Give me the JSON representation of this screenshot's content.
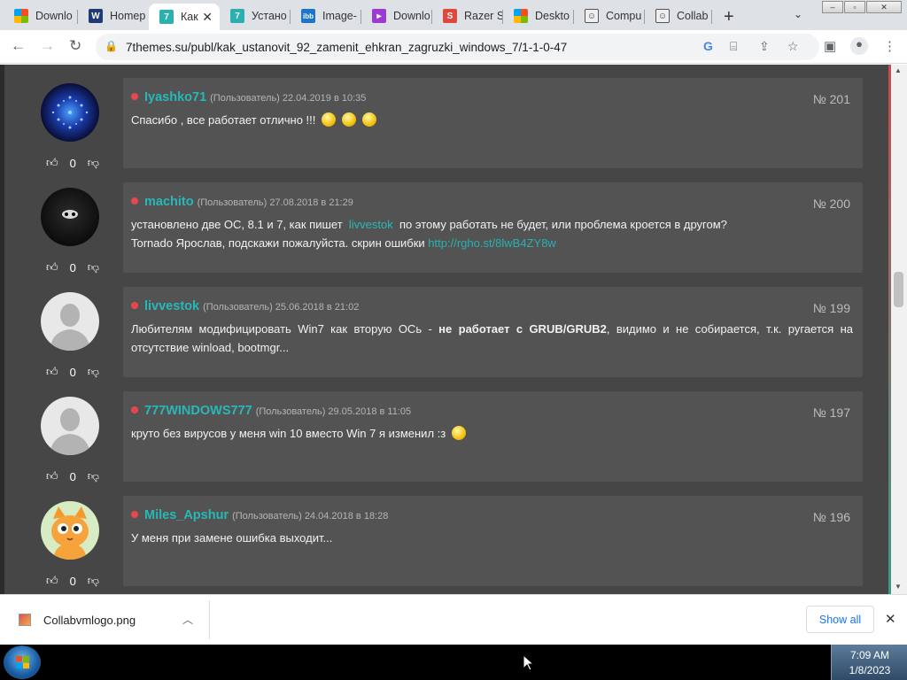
{
  "browser": {
    "tabs": [
      {
        "label": "Downlo",
        "icon": "windows-logo-icon",
        "color": "#f25022"
      },
      {
        "label": "Homep",
        "icon": "site-logo-icon",
        "color": "#1f3b73"
      },
      {
        "label": "Как",
        "icon": "7themes-icon",
        "color": "#2bb0b0",
        "active": true
      },
      {
        "label": "Устано",
        "icon": "7themes-icon",
        "color": "#2bb0b0"
      },
      {
        "label": "Image-",
        "icon": "imgbb-icon",
        "color": "#1c75c8"
      },
      {
        "label": "Downlo",
        "icon": "download-site-icon",
        "color": "#9b3bd1"
      },
      {
        "label": "Razer S",
        "icon": "razer-icon",
        "color": "#e0483e"
      },
      {
        "label": "Deskto",
        "icon": "windows-logo-icon",
        "color": "#f25022"
      },
      {
        "label": "Compu",
        "icon": "collabvm-icon",
        "color": "#555555"
      },
      {
        "label": "Collab",
        "icon": "collabvm-icon",
        "color": "#555555"
      }
    ],
    "url": "7themes.su/publ/kak_ustanovit_92_zamenit_ehkran_zagruzki_windows_7/1-1-0-47"
  },
  "comments": [
    {
      "user": "Iyashko71",
      "role": "(Пользователь)",
      "date": "22.04.2019 в 10:35",
      "number": "№ 201",
      "votes": "0",
      "avatar": "blue-sphere",
      "text": "Спасибо , все работает отлично !!!"
    },
    {
      "user": "machito",
      "role": "(Пользователь)",
      "date": "27.08.2018 в 21:29",
      "number": "№ 200",
      "votes": "0",
      "avatar": "hooded",
      "text_a": "установлено две ОС, 8.1 и 7, как пишет",
      "mention": "livvestok",
      "text_b": "по этому работать не будет, или проблема кроется в другом?",
      "text_c": "Tornado Ярослав, подскажи пожалуйста.   скрин ошибки",
      "link": "http://rgho.st/8lwB4ZY8w"
    },
    {
      "user": "livvestok",
      "role": "(Пользователь)",
      "date": "25.06.2018 в 21:02",
      "number": "№ 199",
      "votes": "0",
      "avatar": "default",
      "text_a": "Любителям модифицировать Win7 как вторую ОСь -",
      "bold": "не работает с GRUB/GRUB2",
      "text_b": ", видимо и не собирается, т.к. ругается на отсутствие winload, bootmgr..."
    },
    {
      "user": "777WINDOWS777",
      "role": "(Пользователь)",
      "date": "29.05.2018 в 11:05",
      "number": "№ 197",
      "votes": "0",
      "avatar": "default",
      "text": "круто без вирусов у меня win 10 вместо Win 7 я изменил :з"
    },
    {
      "user": "Miles_Apshur",
      "role": "(Пользователь)",
      "date": "24.04.2018 в 18:28",
      "number": "№ 196",
      "votes": "0",
      "avatar": "cat",
      "text": "У меня при замене ошибка выходит..."
    }
  ],
  "downloads": {
    "file": "Collabvmlogo.png",
    "show_all": "Show all"
  },
  "taskbar": {
    "time": "7:09 AM",
    "date": "1/8/2023"
  }
}
